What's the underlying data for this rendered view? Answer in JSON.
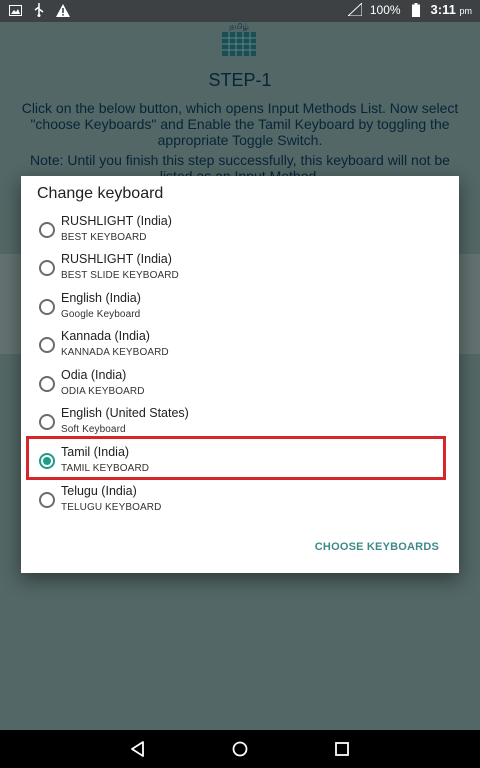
{
  "status_bar": {
    "battery": "100%",
    "time": "3:11",
    "ampm": "pm",
    "icons": [
      "image-icon",
      "usb-icon",
      "warning-icon",
      "signal-icon",
      "battery-icon"
    ]
  },
  "app": {
    "logo_text": "தமிழ்",
    "step_title": "STEP-1",
    "description": "Click on the below button, which opens Input Methods List. Now select \"choose Keyboards\" and Enable the Tamil Keyboard by toggling the appropriate Toggle Switch.",
    "note": "Note: Until you finish this step successfully, this keyboard will not be listed as an Input Method."
  },
  "dialog": {
    "title": "Change keyboard",
    "items": [
      {
        "name": "RUSHLIGHT (India)",
        "sub": "BEST KEYBOARD",
        "checked": false
      },
      {
        "name": "RUSHLIGHT (India)",
        "sub": "BEST SLIDE KEYBOARD",
        "checked": false
      },
      {
        "name": "English (India)",
        "sub": "Google Keyboard",
        "checked": false
      },
      {
        "name": "Kannada (India)",
        "sub": "KANNADA KEYBOARD",
        "checked": false
      },
      {
        "name": "Odia (India)",
        "sub": "ODIA KEYBOARD",
        "checked": false
      },
      {
        "name": "English (United States)",
        "sub": "Soft Keyboard",
        "checked": false
      },
      {
        "name": "Tamil (India)",
        "sub": "TAMIL KEYBOARD",
        "checked": true
      },
      {
        "name": "Telugu (India)",
        "sub": "TELUGU KEYBOARD",
        "checked": false
      }
    ],
    "choose_button": "CHOOSE KEYBOARDS"
  },
  "colors": {
    "accent": "#1e9c87",
    "highlight": "#d5262c",
    "button_text": "#3f8a88"
  }
}
